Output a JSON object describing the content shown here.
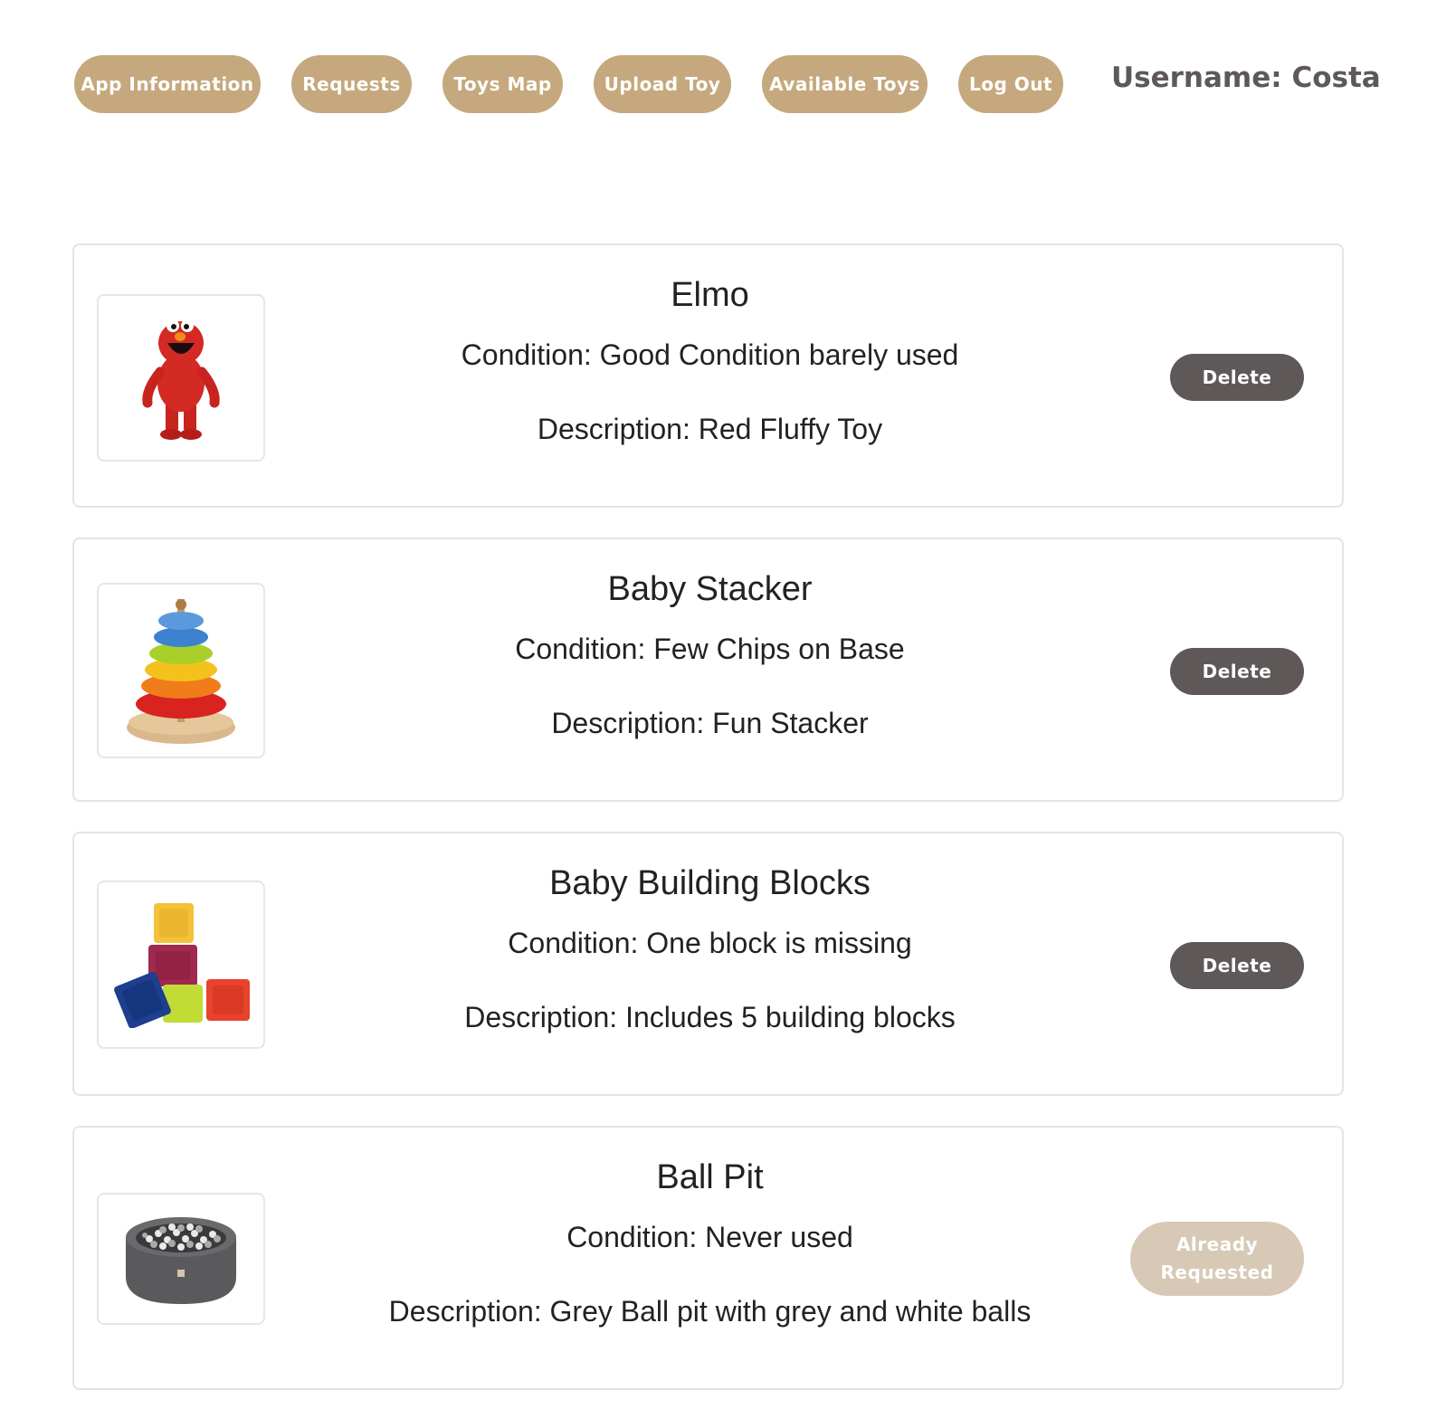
{
  "nav": {
    "app_information": "App Information",
    "requests": "Requests",
    "toys_map": "Toys Map",
    "upload_toy": "Upload Toy",
    "available_toys": "Available Toys",
    "log_out": "Log Out"
  },
  "username": "Username: Costa",
  "toys": [
    {
      "title": "Elmo",
      "condition": "Condition: Good Condition barely used",
      "description": "Description: Red Fluffy Toy",
      "action": "Delete",
      "image": "elmo-plush-toy"
    },
    {
      "title": "Baby Stacker",
      "condition": "Condition: Few Chips on Base",
      "description": "Description: Fun Stacker",
      "action": "Delete",
      "image": "ring-stacker-toy"
    },
    {
      "title": "Baby Building Blocks",
      "condition": "Condition: One block is missing",
      "description": "Description: Includes 5 building blocks",
      "action": "Delete",
      "image": "building-blocks-toy"
    },
    {
      "title": "Ball Pit",
      "condition": "Condition: Never used",
      "description": "Description: Grey Ball pit with grey and white balls",
      "action": "Already Requested",
      "image": "ball-pit-toy"
    }
  ],
  "colors": {
    "nav_button": "#c5a87d",
    "delete_button": "#5e5958",
    "requested_button": "#d7c9b6",
    "username_text": "#5e5958"
  }
}
